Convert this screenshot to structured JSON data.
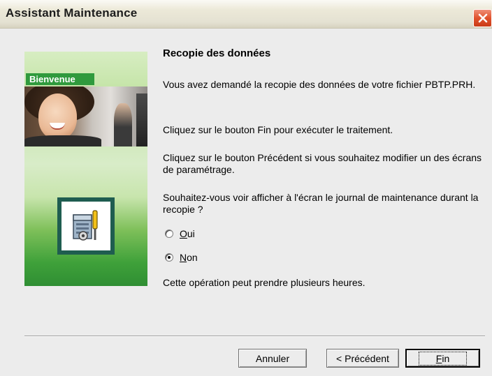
{
  "window": {
    "title": "Assistant Maintenance"
  },
  "sidebar": {
    "welcome_label": "Bienvenue",
    "icon": "maintenance-tools-icon"
  },
  "main": {
    "heading": "Recopie des données",
    "para1": "Vous avez demandé la recopie des données de votre fichier PBTP.PRH.",
    "para2": "Cliquez sur le bouton Fin pour exécuter le traitement.",
    "para3": "Cliquez sur le bouton Précédent si vous souhaitez modifier un des écrans de paramétrage.",
    "question": "Souhaitez-vous voir afficher à l'écran le journal de maintenance durant la recopie ?",
    "options": [
      {
        "label": "Oui",
        "selected": false
      },
      {
        "label": "Non",
        "selected": true
      }
    ],
    "note": "Cette opération peut prendre plusieurs heures."
  },
  "buttons": {
    "cancel": "Annuler",
    "previous": "< Précédent",
    "finish": "Fin"
  },
  "colors": {
    "sidebar_green": "#2f9a3d",
    "frame_teal": "#1f5d50",
    "close_red": "#e0522c"
  }
}
